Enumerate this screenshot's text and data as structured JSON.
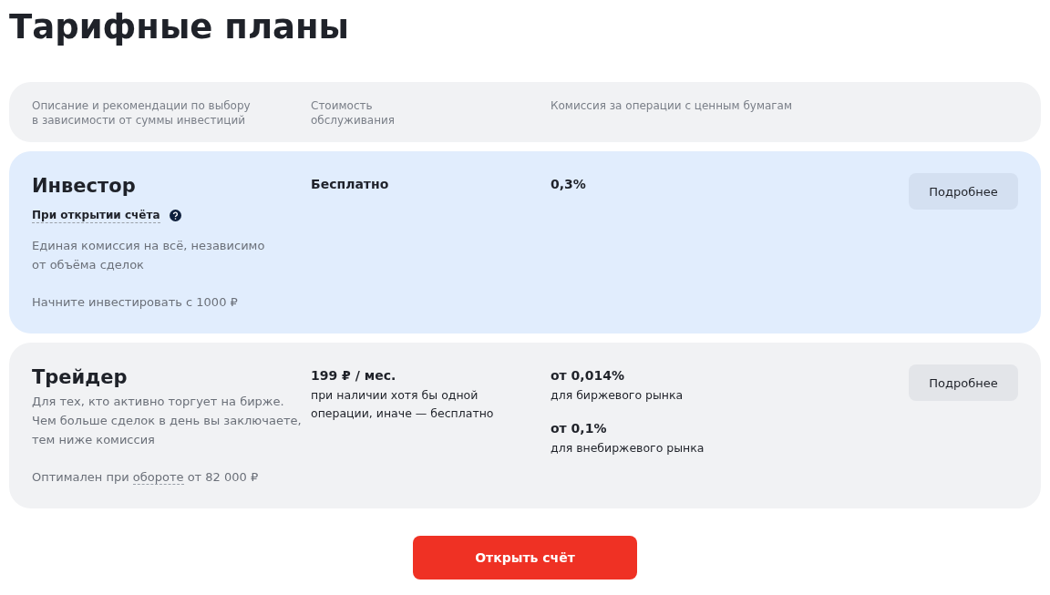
{
  "title": "Тарифные планы",
  "columns": [
    "Описание и рекомендации по выбору\nв зависимости от суммы инвестиций",
    "Стоимость\nобслуживания",
    "Комиссия за операции с ценным бумагам"
  ],
  "plans": [
    {
      "name": "Инвестор",
      "selected": true,
      "hint": "При открытии счёта",
      "description": "Единая комиссия на всё, независимо\nот объёма сделок",
      "footer": {
        "prefix": "Начните инвестировать с 1000 ₽"
      },
      "price": {
        "value": "Бесплатно"
      },
      "commissions": [
        {
          "value": "0,3%"
        }
      ],
      "button": "Подробнее"
    },
    {
      "name": "Трейдер",
      "selected": false,
      "description": "Для тех, кто активно торгует на бирже.\nЧем больше сделок в день вы заключаете,\nтем ниже комиссия",
      "footer": {
        "prefix": "Оптимален при ",
        "link": "обороте",
        "suffix": " от 82 000 ₽"
      },
      "price": {
        "value": "199 ₽ / мес.",
        "note": "при наличии хотя бы одной\nоперации, иначе — бесплатно"
      },
      "commissions": [
        {
          "value": "от 0,014%",
          "note": "для биржевого рынка"
        },
        {
          "value": "от 0,1%",
          "note": "для внебиржевого рынка"
        }
      ],
      "button": "Подробнее"
    }
  ],
  "cta": "Открыть счёт"
}
